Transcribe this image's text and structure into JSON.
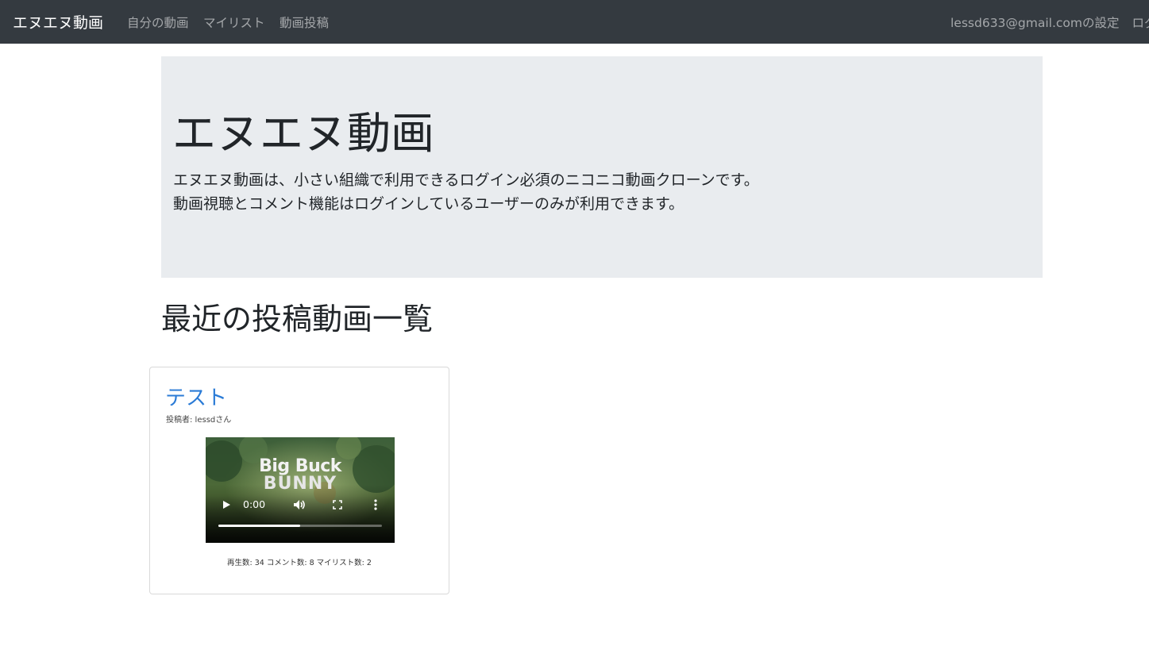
{
  "navbar": {
    "brand": "エヌエヌ動画",
    "links": [
      "自分の動画",
      "マイリスト",
      "動画投稿"
    ],
    "account_settings": "lessd633@gmail.comの設定",
    "logout": "ログアウト"
  },
  "jumbotron": {
    "title": "エヌエヌ動画",
    "line1": "エヌエヌ動画は、小さい組織で利用できるログイン必須のニコニコ動画クローンです。",
    "line2": "動画視聴とコメント機能はログインしているユーザーのみが利用できます。"
  },
  "recent": {
    "heading": "最近の投稿動画一覧",
    "videos": [
      {
        "title": "テスト",
        "author": "投稿者: lessdさん",
        "poster_text_line1": "Big Buck",
        "poster_text_line2": "BUNNY",
        "player": {
          "time": "0:00",
          "progress": 0.5
        },
        "stats": "再生数: 34 コメント数: 8 マイリスト数: 2"
      }
    ]
  },
  "icons": {
    "play": "play-icon",
    "volume": "volume-icon",
    "fullscreen": "fullscreen-icon",
    "more": "more-options-icon"
  },
  "colors": {
    "navbar_bg": "#343a40",
    "jumbotron_bg": "#e9ecef",
    "link": "#2b7bd6"
  }
}
